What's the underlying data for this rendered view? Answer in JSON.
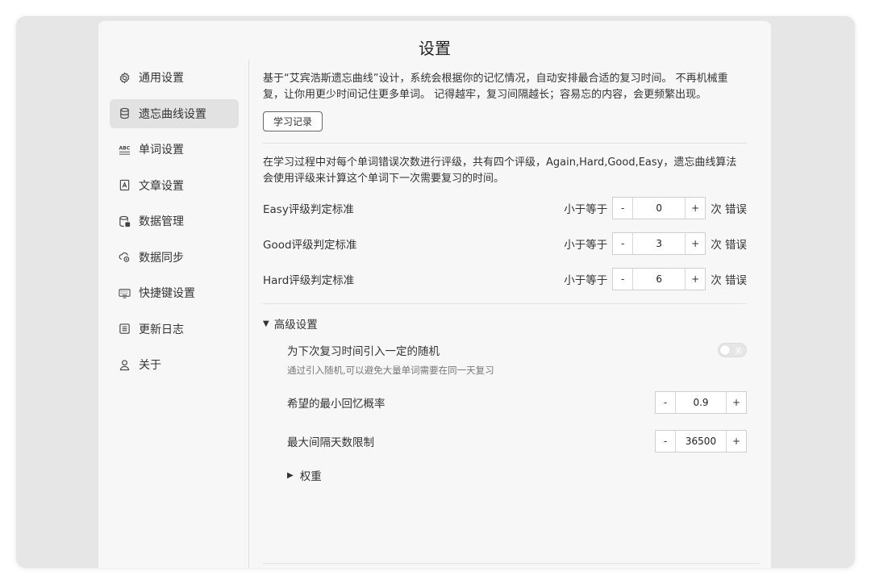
{
  "title": "设置",
  "sidebar": {
    "items": [
      {
        "label": "通用设置",
        "icon": "gear-icon"
      },
      {
        "label": "遗忘曲线设置",
        "icon": "database-icon"
      },
      {
        "label": "单词设置",
        "icon": "abc-icon"
      },
      {
        "label": "文章设置",
        "icon": "article-icon"
      },
      {
        "label": "数据管理",
        "icon": "data-manage-icon"
      },
      {
        "label": "数据同步",
        "icon": "cloud-sync-icon"
      },
      {
        "label": "快捷键设置",
        "icon": "keyboard-icon"
      },
      {
        "label": "更新日志",
        "icon": "log-icon"
      },
      {
        "label": "关于",
        "icon": "user-icon"
      }
    ],
    "active": "遗忘曲线设置"
  },
  "main": {
    "description": "基于“艾宾浩斯遗忘曲线”设计，系统会根据你的记忆情况，自动安排最合适的复习时间。 不再机械重复，让你用更少时间记住更多单词。 记得越牢，复习间隔越长；容易忘的内容，会更频繁出现。",
    "record_button": "学习记录",
    "grading_description": "在学习过程中对每个单词错误次数进行评级，共有四个评级，Again,Hard,Good,Easy，遗忘曲线算法会使用评级来计算这个单词下一次需要复习的时间。",
    "grades": [
      {
        "label": "Easy评级判定标准",
        "prefix": "小于等于",
        "minus": "-",
        "value": "0",
        "plus": "+",
        "suffix": "次 错误"
      },
      {
        "label": "Good评级判定标准",
        "prefix": "小于等于",
        "minus": "-",
        "value": "3",
        "plus": "+",
        "suffix": "次 错误"
      },
      {
        "label": "Hard评级判定标准",
        "prefix": "小于等于",
        "minus": "-",
        "value": "6",
        "plus": "+",
        "suffix": "次 错误"
      }
    ],
    "advanced": {
      "toggle_arrow": "▼",
      "label": "高级设置",
      "random": {
        "label": "为下次复习时间引入一定的随机",
        "hint": "通过引入随机,可以避免大量单词需要在同一天复习",
        "toggle_text": "关",
        "enabled": false
      },
      "min_recall": {
        "label": "希望的最小回忆概率",
        "minus": "-",
        "value": "0.9",
        "plus": "+"
      },
      "max_interval": {
        "label": "最大间隔天数限制",
        "minus": "-",
        "value": "36500",
        "plus": "+"
      },
      "weights": {
        "arrow": "▶",
        "label": "权重"
      }
    }
  }
}
